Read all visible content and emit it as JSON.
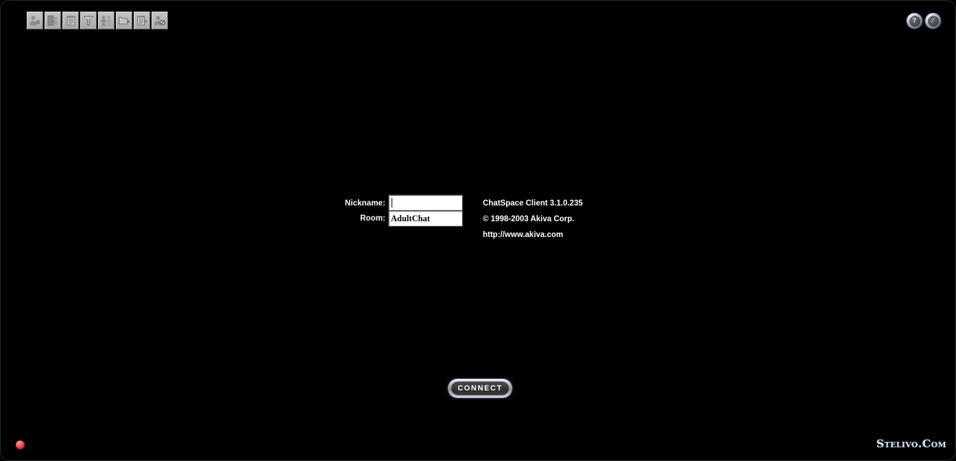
{
  "window": {
    "title": "ChatSpace Client",
    "background_color": "#000000"
  },
  "toolbar": {
    "buttons": [
      {
        "name": "user-profile-icon",
        "tooltip": "Profile"
      },
      {
        "name": "door-exit-icon",
        "tooltip": "Exit Room"
      },
      {
        "name": "notepad-list-icon",
        "tooltip": "Message Log"
      },
      {
        "name": "funnel-filter-icon",
        "tooltip": "Filter"
      },
      {
        "name": "people-group-icon",
        "tooltip": "User List"
      },
      {
        "name": "folder-arrow-icon",
        "tooltip": "Rooms"
      },
      {
        "name": "document-arrow-icon",
        "tooltip": "Scripts"
      },
      {
        "name": "user-block-icon",
        "tooltip": "Ignore List"
      }
    ]
  },
  "titlebar": {
    "buttons": [
      {
        "name": "help-icon",
        "glyph": "?",
        "tooltip": "Help"
      },
      {
        "name": "disconnect-icon",
        "glyph": "∕",
        "tooltip": "Disconnect"
      }
    ]
  },
  "login": {
    "nickname": {
      "label": "Nickname:",
      "value": "",
      "placeholder": ""
    },
    "room": {
      "label": "Room:",
      "value": "AdultChat",
      "placeholder": ""
    }
  },
  "client_info": {
    "lines": [
      "ChatSpace Client 3.1.0.235",
      "© 1998-2003 Akiva Corp.",
      "http://www.akiva.com"
    ]
  },
  "connect": {
    "label": "CONNECT"
  },
  "status": {
    "led_color": "#d42020",
    "led_state": "disconnected"
  },
  "watermark": {
    "text": "Stelivo.Com",
    "color": "#d8e4f4"
  },
  "colors": {
    "background": "#000000",
    "toolbar_face": "#b4b4b4",
    "text": "#ffffff",
    "field_background": "#ffffff",
    "accent_led": "#d42020"
  }
}
